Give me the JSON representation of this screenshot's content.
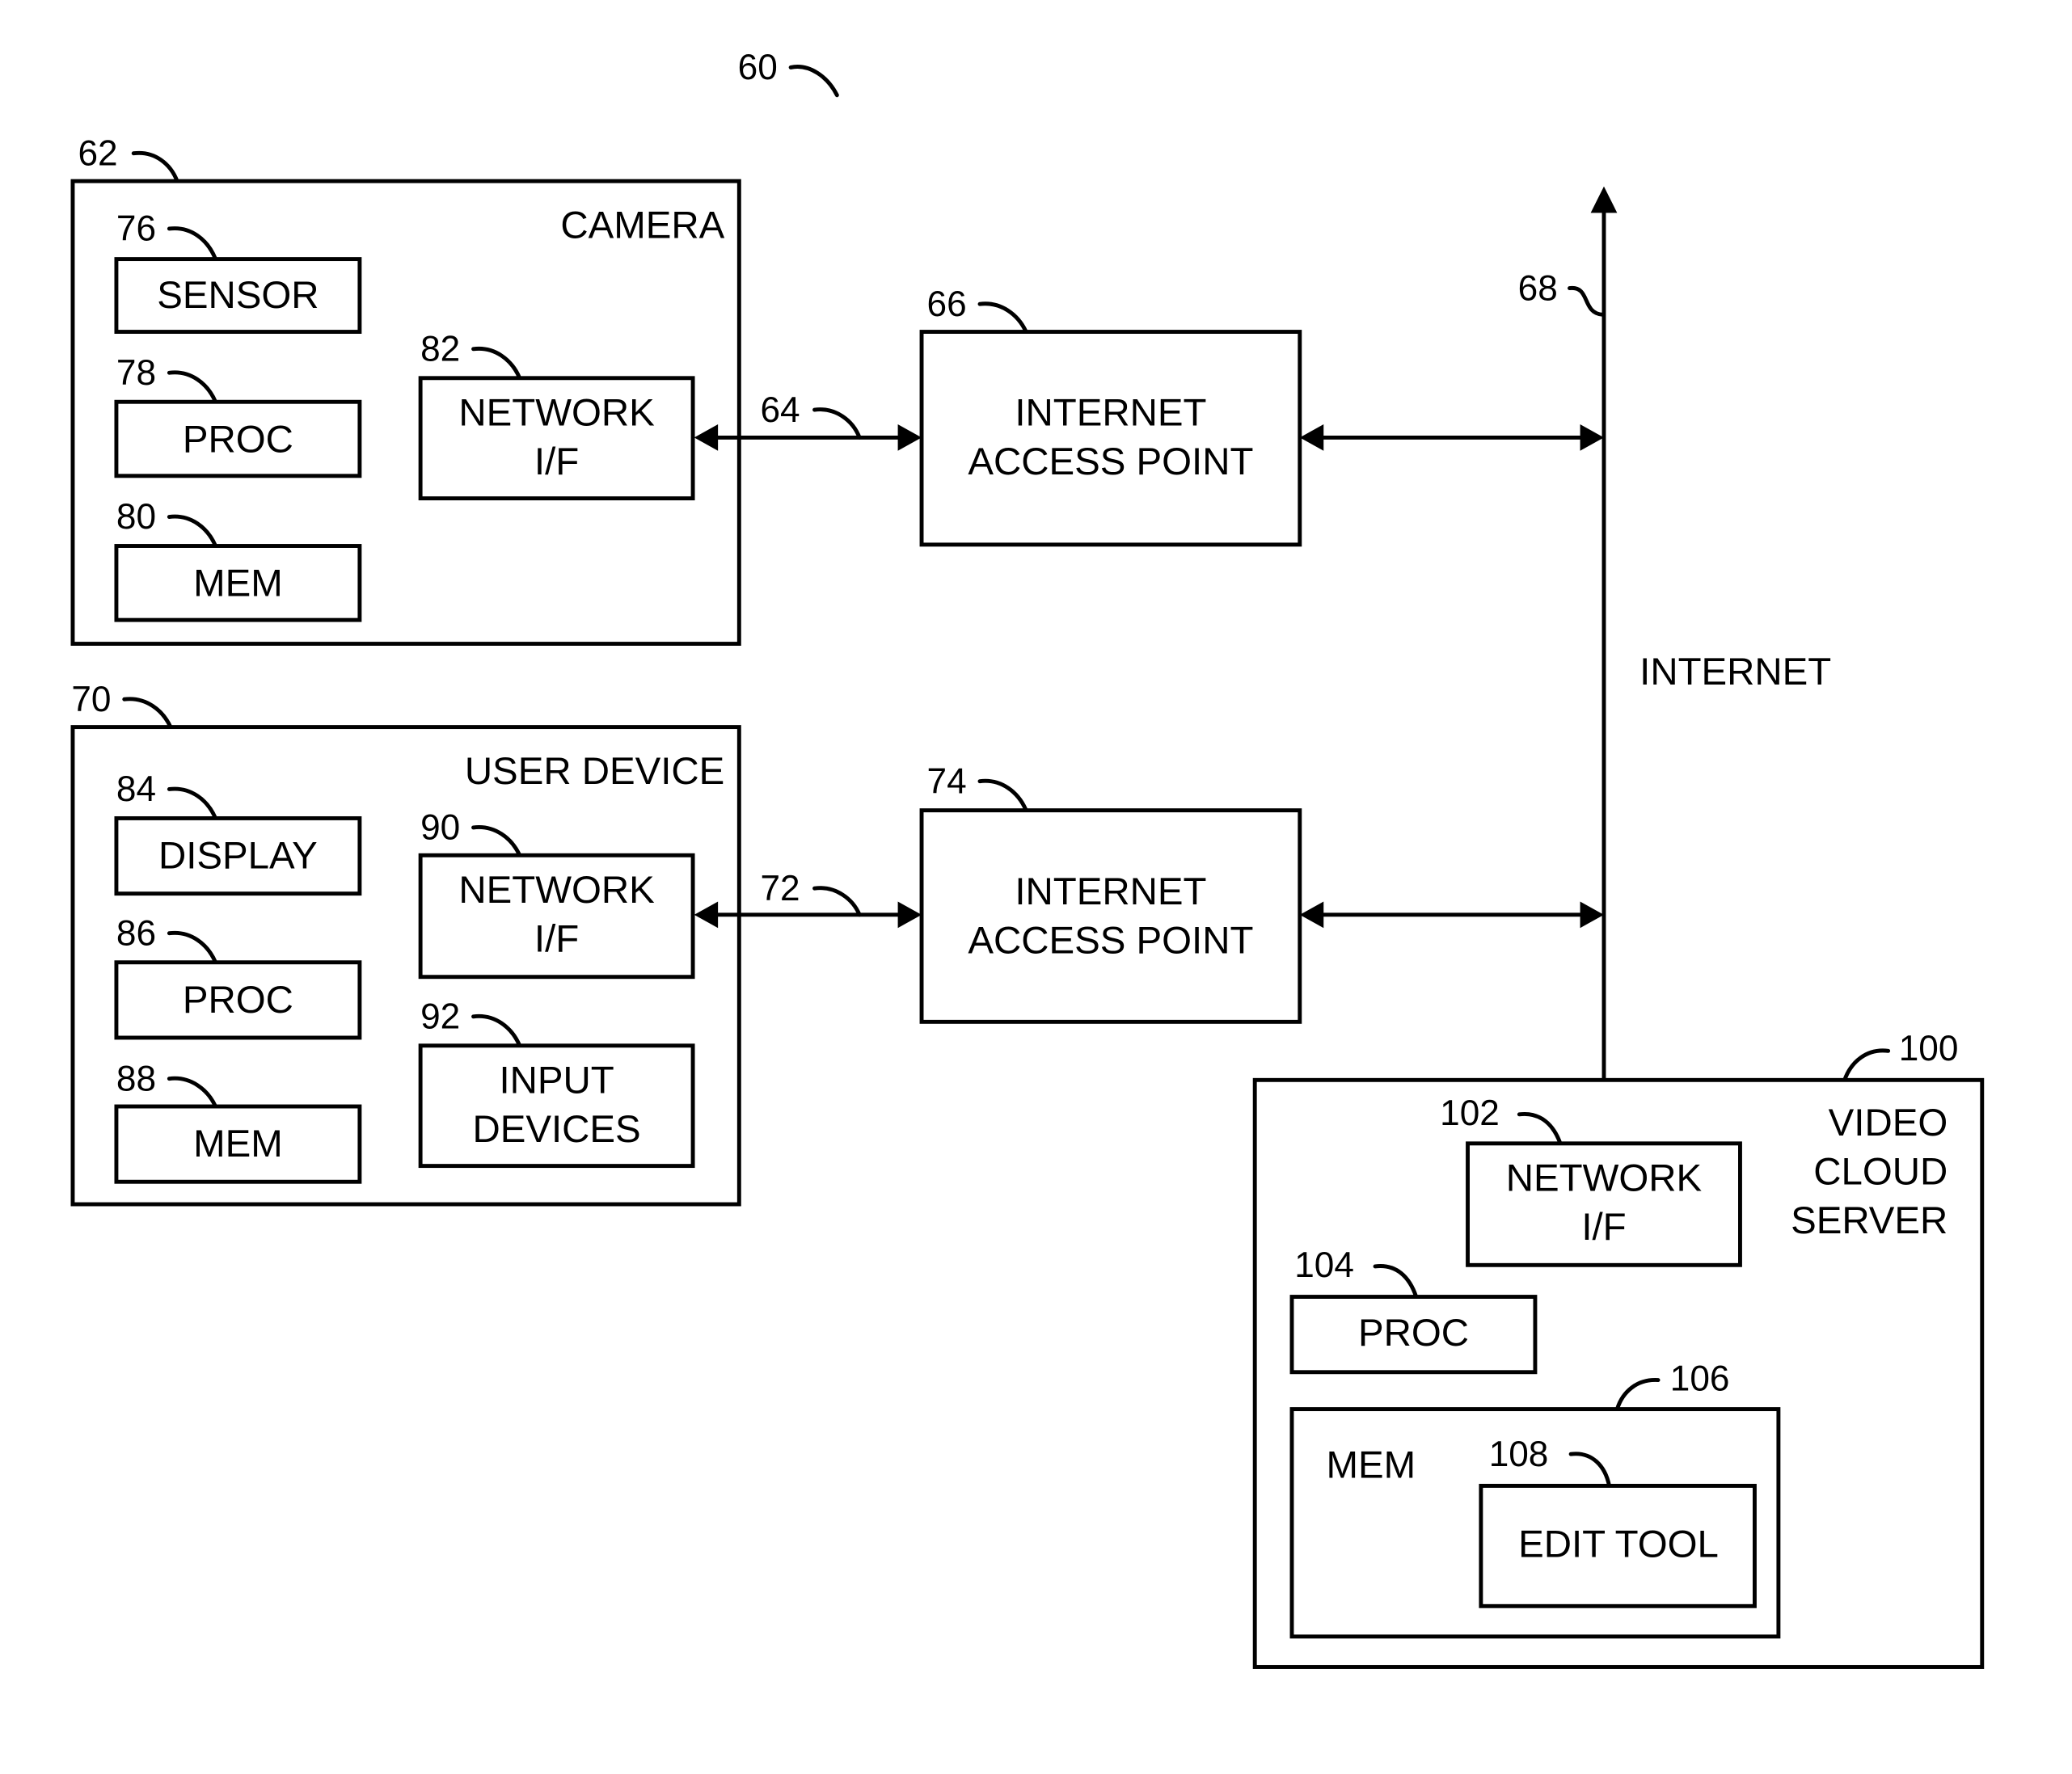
{
  "figure": {
    "ref": "60",
    "colors": {
      "stroke": "#000000",
      "background": "#ffffff"
    }
  },
  "camera": {
    "ref": "62",
    "title": "CAMERA",
    "components": {
      "sensor": {
        "ref": "76",
        "label": "SENSOR"
      },
      "proc": {
        "ref": "78",
        "label": "PROC"
      },
      "mem": {
        "ref": "80",
        "label": "MEM"
      },
      "network_if": {
        "ref": "82",
        "label_line1": "NETWORK",
        "label_line2": "I/F"
      }
    }
  },
  "camera_link": {
    "ref": "64"
  },
  "access_point_1": {
    "ref": "66",
    "label_line1": "INTERNET",
    "label_line2": "ACCESS POINT"
  },
  "internet": {
    "ref": "68",
    "label": "INTERNET"
  },
  "user_device": {
    "ref": "70",
    "title": "USER DEVICE",
    "components": {
      "display": {
        "ref": "84",
        "label": "DISPLAY"
      },
      "proc": {
        "ref": "86",
        "label": "PROC"
      },
      "mem": {
        "ref": "88",
        "label": "MEM"
      },
      "network_if": {
        "ref": "90",
        "label_line1": "NETWORK",
        "label_line2": "I/F"
      },
      "input_devices": {
        "ref": "92",
        "label_line1": "INPUT",
        "label_line2": "DEVICES"
      }
    }
  },
  "user_link": {
    "ref": "72"
  },
  "access_point_2": {
    "ref": "74",
    "label_line1": "INTERNET",
    "label_line2": "ACCESS POINT"
  },
  "server": {
    "ref": "100",
    "title_line1": "VIDEO",
    "title_line2": "CLOUD",
    "title_line3": "SERVER",
    "components": {
      "network_if": {
        "ref": "102",
        "label_line1": "NETWORK",
        "label_line2": "I/F"
      },
      "proc": {
        "ref": "104",
        "label": "PROC"
      },
      "mem": {
        "ref": "106",
        "label": "MEM"
      },
      "edit_tool": {
        "ref": "108",
        "label": "EDIT TOOL"
      }
    }
  }
}
